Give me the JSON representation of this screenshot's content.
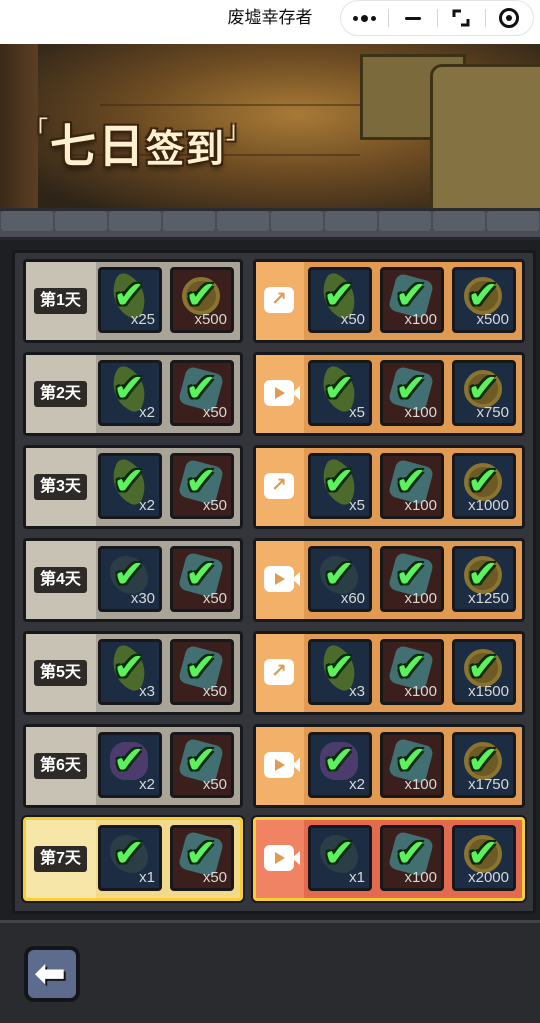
{
  "app": {
    "title": "废墟幸存者"
  },
  "banner": {
    "bracket_open": "「",
    "title_main": "七日",
    "title_small": "签到",
    "bracket_close": "」"
  },
  "rows": [
    {
      "day": "第1天",
      "action": "share",
      "free": [
        {
          "kind": "herb",
          "qty": "x25"
        },
        {
          "kind": "coin",
          "qty": "x500"
        }
      ],
      "bonus": [
        {
          "kind": "herb",
          "qty": "x50"
        },
        {
          "kind": "crystal",
          "qty": "x100"
        },
        {
          "kind": "coin",
          "qty": "x500"
        }
      ]
    },
    {
      "day": "第2天",
      "action": "video",
      "free": [
        {
          "kind": "herb",
          "qty": "x2"
        },
        {
          "kind": "crystal",
          "qty": "x50"
        }
      ],
      "bonus": [
        {
          "kind": "herb",
          "qty": "x5"
        },
        {
          "kind": "crystal",
          "qty": "x100"
        },
        {
          "kind": "coin",
          "qty": "x750"
        }
      ]
    },
    {
      "day": "第3天",
      "action": "share",
      "free": [
        {
          "kind": "herb",
          "qty": "x2"
        },
        {
          "kind": "crystal",
          "qty": "x50"
        }
      ],
      "bonus": [
        {
          "kind": "herb",
          "qty": "x5"
        },
        {
          "kind": "crystal",
          "qty": "x100"
        },
        {
          "kind": "coin",
          "qty": "x1000"
        }
      ]
    },
    {
      "day": "第4天",
      "action": "video",
      "free": [
        {
          "kind": "dark",
          "qty": "x30"
        },
        {
          "kind": "crystal",
          "qty": "x50"
        }
      ],
      "bonus": [
        {
          "kind": "dark",
          "qty": "x60"
        },
        {
          "kind": "crystal",
          "qty": "x100"
        },
        {
          "kind": "coin",
          "qty": "x1250"
        }
      ]
    },
    {
      "day": "第5天",
      "action": "share",
      "free": [
        {
          "kind": "herb",
          "qty": "x3"
        },
        {
          "kind": "crystal",
          "qty": "x50"
        }
      ],
      "bonus": [
        {
          "kind": "herb",
          "qty": "x3"
        },
        {
          "kind": "crystal",
          "qty": "x100"
        },
        {
          "kind": "coin",
          "qty": "x1500"
        }
      ]
    },
    {
      "day": "第6天",
      "action": "video",
      "free": [
        {
          "kind": "purple",
          "qty": "x2"
        },
        {
          "kind": "crystal",
          "qty": "x50"
        }
      ],
      "bonus": [
        {
          "kind": "purple",
          "qty": "x2"
        },
        {
          "kind": "crystal",
          "qty": "x100"
        },
        {
          "kind": "coin",
          "qty": "x1750"
        }
      ]
    },
    {
      "day": "第7天",
      "action": "video",
      "free": [
        {
          "kind": "dark",
          "qty": "x1"
        },
        {
          "kind": "crystal",
          "qty": "x50"
        }
      ],
      "bonus": [
        {
          "kind": "dark",
          "qty": "x1"
        },
        {
          "kind": "crystal",
          "qty": "x100"
        },
        {
          "kind": "coin",
          "qty": "x2000"
        }
      ]
    }
  ],
  "icons": {
    "check": "✔",
    "back": "back-arrow-icon",
    "share": "share-icon",
    "video": "video-icon"
  },
  "colors": {
    "free_bg": "#a9a497",
    "bonus_bg": "#e09a52",
    "last_free_bg": "#f2d98b",
    "last_bonus_bg": "#e36a4e",
    "check": "#5cf25e"
  }
}
